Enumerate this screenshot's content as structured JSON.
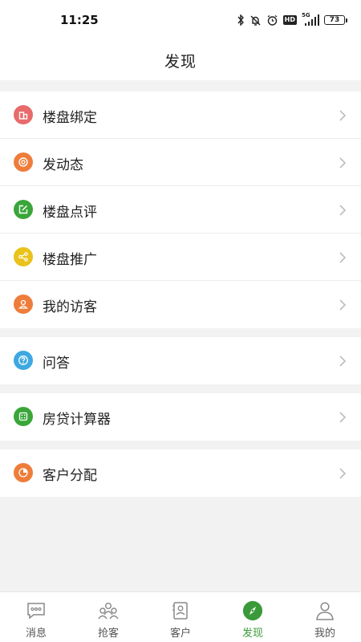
{
  "status_bar": {
    "time": "11:25",
    "network": "5G",
    "hd": "HD",
    "battery": "73",
    "icons": [
      "bluetooth-icon",
      "mute-icon",
      "alarm-icon",
      "hd-icon",
      "signal-icon",
      "battery-icon"
    ]
  },
  "header": {
    "title": "发现"
  },
  "groups": [
    {
      "items": [
        {
          "label": "楼盘绑定",
          "icon": "building-icon",
          "color": "#e86a6a"
        },
        {
          "label": "发动态",
          "icon": "target-icon",
          "color": "#ee7d3b"
        },
        {
          "label": "楼盘点评",
          "icon": "edit-icon",
          "color": "#3aa63a"
        },
        {
          "label": "楼盘推广",
          "icon": "share-icon",
          "color": "#e9c21c"
        },
        {
          "label": "我的访客",
          "icon": "visitor-icon",
          "color": "#ee7d3b"
        }
      ]
    },
    {
      "items": [
        {
          "label": "问答",
          "icon": "question-icon",
          "color": "#3ea8e0"
        }
      ]
    },
    {
      "items": [
        {
          "label": "房贷计算器",
          "icon": "calculator-icon",
          "color": "#3aa63a"
        }
      ]
    },
    {
      "items": [
        {
          "label": "客户分配",
          "icon": "pie-chart-icon",
          "color": "#ee7d3b"
        }
      ]
    }
  ],
  "tabs": [
    {
      "label": "消息",
      "icon": "chat-icon",
      "active": false
    },
    {
      "label": "抢客",
      "icon": "people-icon",
      "active": false
    },
    {
      "label": "客户",
      "icon": "contact-card-icon",
      "active": false
    },
    {
      "label": "发现",
      "icon": "compass-icon",
      "active": true
    },
    {
      "label": "我的",
      "icon": "person-icon",
      "active": false
    }
  ],
  "colors": {
    "accent": "#3a9a3a",
    "background": "#f2f2f2",
    "text": "#222222",
    "inactive_tab": "#555555"
  }
}
